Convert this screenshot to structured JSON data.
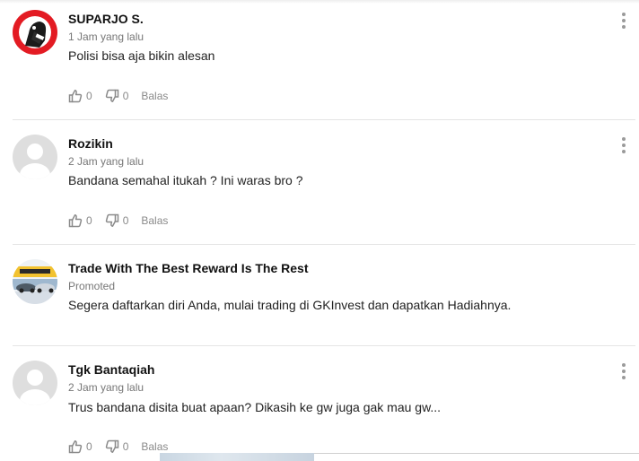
{
  "comments": [
    {
      "name": "SUPARJO S.",
      "time": "1 Jam yang lalu",
      "text": "Polisi bisa aja bikin alesan",
      "likes": "0",
      "dislikes": "0",
      "reply_label": "Balas"
    },
    {
      "name": "Rozikin",
      "time": "2 Jam yang lalu",
      "text": "Bandana semahal itukah ? Ini waras bro ?",
      "likes": "0",
      "dislikes": "0",
      "reply_label": "Balas"
    },
    {
      "name": "Tgk Bantaqiah",
      "time": "2 Jam yang lalu",
      "text": "Trus bandana disita buat apaan? Dikasih ke gw juga gak mau gw...",
      "likes": "0",
      "dislikes": "0",
      "reply_label": "Balas"
    }
  ],
  "promoted": {
    "title": "Trade With The Best Reward Is The Rest",
    "label": "Promoted",
    "text": "Segera daftarkan diri Anda, mulai trading di GKInvest dan dapatkan Hadiahnya."
  },
  "icons": {
    "like": "thumbs-up-icon",
    "dislike": "thumbs-down-icon",
    "menu": "more-vertical-icon",
    "avatar_default": "default-user-avatar-icon"
  },
  "colors": {
    "name": "#111111",
    "meta": "#777777",
    "actions": "#8a8a8a",
    "avatar_red": "#e31b23"
  }
}
